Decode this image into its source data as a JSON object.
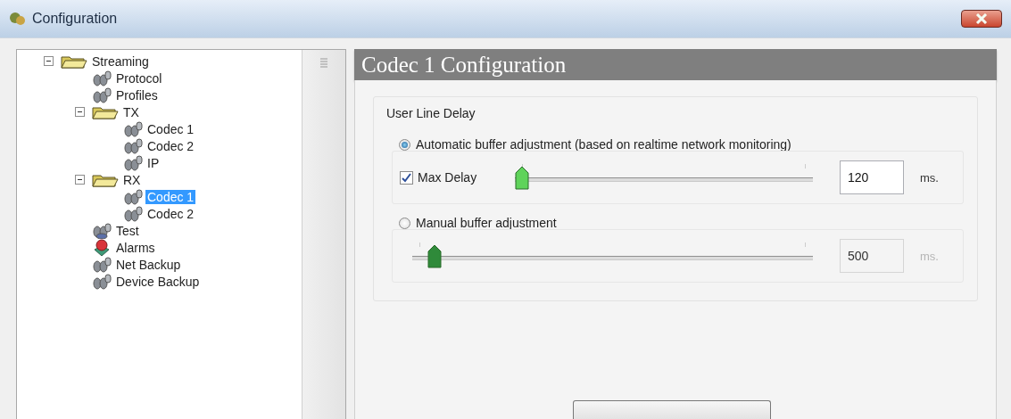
{
  "window": {
    "title": "Configuration"
  },
  "tree": [
    {
      "label": "Streaming",
      "kind": "folder",
      "expanded": true,
      "selected": false,
      "children": [
        {
          "label": "Protocol",
          "kind": "node",
          "selected": false
        },
        {
          "label": "Profiles",
          "kind": "node",
          "selected": false
        },
        {
          "label": "TX",
          "kind": "folder",
          "expanded": true,
          "selected": false,
          "children": [
            {
              "label": "Codec 1",
              "kind": "node",
              "selected": false
            },
            {
              "label": "Codec 2",
              "kind": "node",
              "selected": false
            },
            {
              "label": "IP",
              "kind": "node",
              "selected": false
            }
          ]
        },
        {
          "label": "RX",
          "kind": "folder",
          "expanded": true,
          "selected": false,
          "children": [
            {
              "label": "Codec 1",
              "kind": "node",
              "selected": true
            },
            {
              "label": "Codec 2",
              "kind": "node",
              "selected": false
            }
          ]
        },
        {
          "label": "Test",
          "kind": "test",
          "selected": false
        },
        {
          "label": "Alarms",
          "kind": "alarm",
          "selected": false
        },
        {
          "label": "Net Backup",
          "kind": "node",
          "selected": false
        },
        {
          "label": "Device Backup",
          "kind": "node",
          "selected": false
        }
      ]
    }
  ],
  "panel": {
    "title": "Codec 1 Configuration",
    "group": {
      "label": "User Line Delay",
      "options": [
        {
          "label": "Automatic buffer adjustment (based on realtime network monitoring)",
          "selected": true,
          "disabled": false,
          "checkbox": {
            "label": "Max Delay",
            "checked": true
          },
          "slider": {
            "level": 0.0
          },
          "value": "120",
          "unit": "ms."
        },
        {
          "label": "Manual buffer adjustment",
          "selected": false,
          "disabled": true,
          "slider": {
            "level": 0.04
          },
          "value": "500",
          "unit": "ms."
        }
      ]
    }
  }
}
